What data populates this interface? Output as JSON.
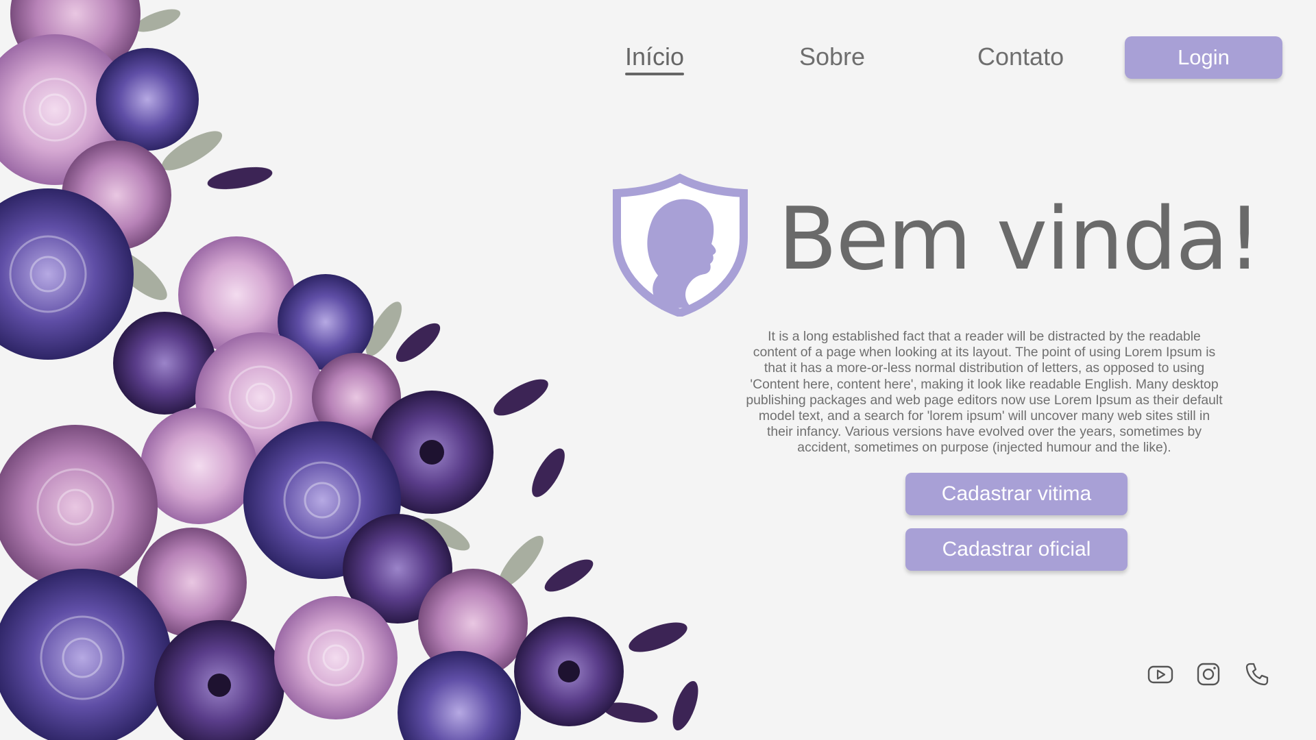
{
  "nav": {
    "links": [
      {
        "label": "Início",
        "active": true
      },
      {
        "label": "Sobre",
        "active": false
      },
      {
        "label": "Contato",
        "active": false
      }
    ],
    "login_label": "Login"
  },
  "hero": {
    "logo_icon": "shield-woman-profile-icon",
    "title": "Bem vinda!",
    "body": "It is a long established fact that a reader will be distracted by the  readable content of a page when looking at its layout. The point of  using Lorem Ipsum is that it has a more-or-less normal distribution of  letters, as opposed to using 'Content here, content here', making it  look like readable English. Many desktop publishing packages and web  page editors now use Lorem Ipsum as their default model text, and a  search for 'lorem ipsum' will uncover many web sites still in their  infancy. Various versions have evolved over the years, sometimes by accident, sometimes on purpose (injected humour and the like).",
    "buttons": {
      "register_victim": "Cadastrar vitima",
      "register_officer": "Cadastrar oficial"
    }
  },
  "social": {
    "icons": [
      "youtube-icon",
      "instagram-icon",
      "phone-icon"
    ]
  },
  "theme": {
    "background": "#f4f4f4",
    "accent": "#a8a0d6",
    "text": "#6a6a6a",
    "floral_dark": "#4a3f8c",
    "floral_mid": "#7a5fae",
    "floral_light": "#d9b3d8"
  }
}
